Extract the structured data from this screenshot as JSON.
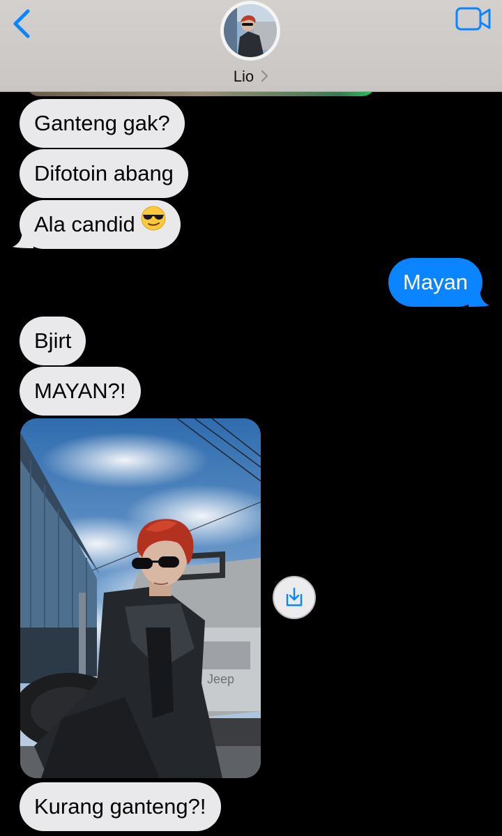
{
  "header": {
    "contact_name": "Lio",
    "back_icon": "chevron-left-icon",
    "video_icon": "video-camera-icon",
    "name_chevron_icon": "chevron-right-icon",
    "accent_color": "#0a84ff"
  },
  "messages": [
    {
      "direction": "incoming",
      "text": "Ganteng gak?"
    },
    {
      "direction": "incoming",
      "text": "Difotoin abang"
    },
    {
      "direction": "incoming",
      "text": "Ala candid",
      "emoji": "smiling-face-with-sunglasses"
    },
    {
      "direction": "outgoing",
      "text": "Mayan"
    },
    {
      "direction": "incoming",
      "text": "Bjirt"
    },
    {
      "direction": "incoming",
      "text": "MAYAN?!"
    },
    {
      "direction": "incoming",
      "type": "photo",
      "description_icon": "photo"
    },
    {
      "direction": "incoming",
      "text": "Kurang ganteng?!"
    }
  ],
  "photo_actions": {
    "save_icon": "save-download-icon"
  },
  "colors": {
    "incoming_bubble": "#e9e9eb",
    "outgoing_bubble": "#0a84ff",
    "background": "#000000"
  }
}
